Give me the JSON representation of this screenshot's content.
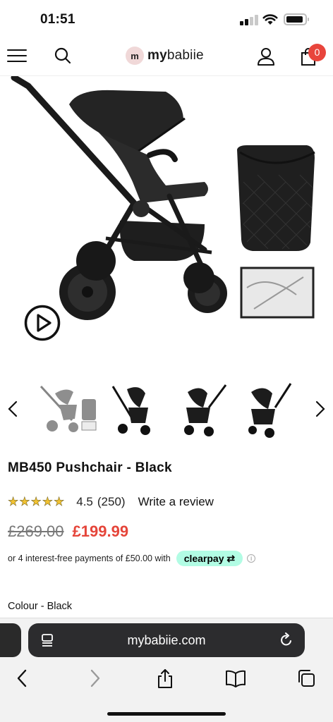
{
  "status_bar": {
    "time": "01:51"
  },
  "header": {
    "logo_mark": "m",
    "logo_text_bold": "my",
    "logo_text_rest": "babiie",
    "cart_count": "0"
  },
  "carousel": {
    "thumbnails": [
      "pushchair-with-accessories",
      "pushchair-front",
      "pushchair-side",
      "pushchair-angle"
    ]
  },
  "product": {
    "title": "MB450 Pushchair - Black",
    "rating": "4.5",
    "rating_stars": 4.5,
    "review_count": "(250)",
    "write_review": "Write a review",
    "price_old": "£269.00",
    "price_new": "£199.99",
    "installments_text": "or 4 interest-free payments of £50.00 with",
    "clearpay_label": "clearpay",
    "colour_label": "Colour - Black"
  },
  "browser": {
    "url": "mybabiie.com",
    "nav": [
      "back-icon",
      "forward-icon",
      "share-icon",
      "bookmarks-icon",
      "tabs-icon"
    ]
  },
  "colors": {
    "accent_price": "#e5453a",
    "cart_badge": "#e8453c",
    "clearpay": "#b2fce4",
    "stars": "#f2c230"
  }
}
